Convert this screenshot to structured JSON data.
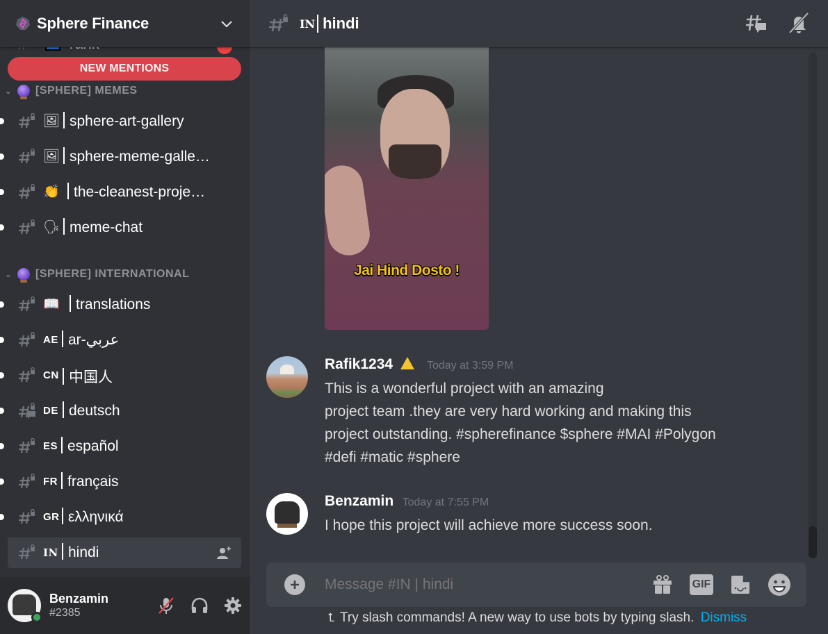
{
  "server": {
    "name": "Sphere Finance",
    "icon": "sphere-server-icon",
    "menu_icon": "chevron-down-icon"
  },
  "sidebar": {
    "partial_channel": {
      "emoji": "blue-badge-emoji",
      "name": "rank"
    },
    "new_mentions_label": "NEW MENTIONS",
    "categories": [
      {
        "label": "[SPHERE] MEMES",
        "channels": [
          {
            "emoji": "🖼",
            "name": "sphere-art-gallery",
            "unread": true,
            "locked": true
          },
          {
            "emoji": "🖼",
            "name": "sphere-meme-galle…",
            "unread": true,
            "locked": true
          },
          {
            "emoji": "👏",
            "name": "the-cleanest-proje…",
            "unread": true,
            "locked": true
          },
          {
            "emoji": "🗣",
            "name": "meme-chat",
            "unread": true,
            "locked": true
          }
        ]
      },
      {
        "label": "[SPHERE] INTERNATIONAL",
        "channels": [
          {
            "emoji": "📖",
            "name": "translations",
            "unread": true,
            "locked": true
          },
          {
            "code": "AE",
            "name": "ar-عربي",
            "unread": true,
            "locked": true
          },
          {
            "code": "CN",
            "name": "中国人",
            "unread": true,
            "locked": true
          },
          {
            "code": "DE",
            "name": "deutsch",
            "unread": true,
            "locked": true,
            "threads": true
          },
          {
            "code": "ES",
            "name": "español",
            "unread": true,
            "locked": true
          },
          {
            "code": "FR",
            "name": "français",
            "unread": true,
            "locked": true
          },
          {
            "code": "GR",
            "name": "ελληνικά",
            "unread": true,
            "locked": true
          },
          {
            "code": "IN",
            "name": "hindi",
            "unread": false,
            "locked": true,
            "active": true
          }
        ]
      }
    ]
  },
  "user_panel": {
    "username": "Benzamin",
    "discriminator": "#2385",
    "status": "online",
    "status_color": "#3ba55d",
    "mic_muted": true
  },
  "channel_header": {
    "code": "IN",
    "name": "hindi",
    "icons": [
      "threads-icon",
      "notifications-muted-icon"
    ]
  },
  "messages": {
    "gif_caption": "Jai Hind Dosto !",
    "items": [
      {
        "author": "Rafik1234",
        "badge": "warning-triangle-badge",
        "timestamp": "Today at 3:59 PM",
        "lines": [
          "This is a wonderful project with an amazing",
          "project team .they are very hard working and making this",
          "project outstanding. #spherefinance $sphere #MAI #Polygon",
          "#defi #matic #sphere"
        ]
      },
      {
        "author": "Benzamin",
        "timestamp": "Today at 7:55 PM",
        "lines": [
          "I hope this project will achieve more success soon."
        ]
      }
    ]
  },
  "composer": {
    "placeholder": "Message #IN | hindi",
    "gif_label": "GIF",
    "buttons": [
      "attach-plus-icon",
      "gift-icon",
      "gif-icon",
      "sticker-icon",
      "emoji-icon"
    ]
  },
  "slash_tip": {
    "text": "Try slash commands! A new way to use bots by typing slash.",
    "dismiss": "Dismiss"
  },
  "colors": {
    "accent_link": "#00aff4",
    "mention_red": "#d9434b",
    "online_green": "#3ba55d"
  }
}
